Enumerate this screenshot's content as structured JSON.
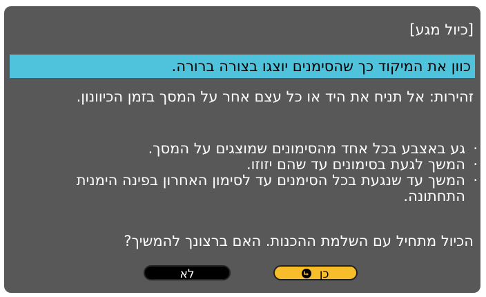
{
  "dialog": {
    "title": "[כיול מגע]",
    "instruction": "כוון את המיקוד כך שהסימנים יוצגו בצורה ברורה.",
    "warning": "זהירות: אל תניח את היד או כל עצם אחר על המסך בזמן הכיוונון.",
    "steps": [
      "גע באצבע בכל אחד מהסימונים שמוצגים על המסך.",
      "המשך לגעת בסימונים עד שהם יזוזו.",
      "המשך עד שנגעת בכל הסימנים עד לסימון האחרון בפינה הימנית התחתונה."
    ],
    "question": "הכיול מתחיל עם השלמת ההכנות. האם ברצונך להמשיך?",
    "bullet": "·",
    "buttons": {
      "yes_label": "כן",
      "no_label": "לא"
    },
    "colors": {
      "background": "#585858",
      "highlight": "#4fc3dc",
      "yes_button": "#f7bd2a",
      "no_button": "#000000"
    }
  }
}
